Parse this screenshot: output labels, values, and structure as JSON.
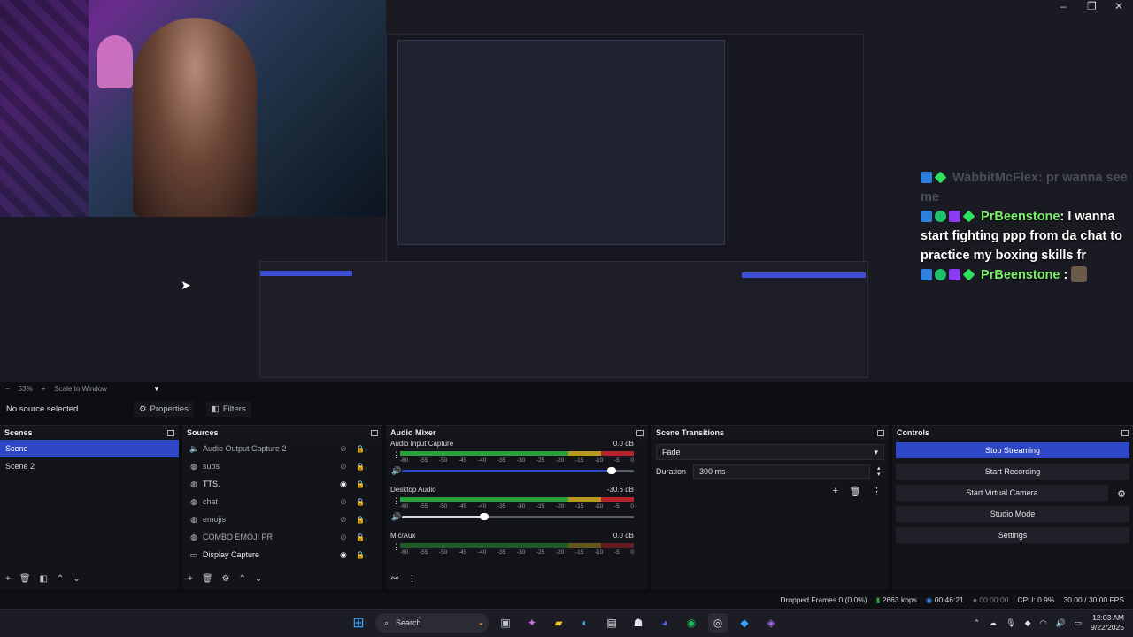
{
  "preview": {
    "chat": [
      {
        "name": "WabbitMcFlex",
        "text": ": pr wanna see me",
        "faded": true
      },
      {
        "name": "PrBeenstone",
        "text": ": I wanna start fighting ppp from da chat to practice my boxing skills fr",
        "faded": false
      },
      {
        "name": "PrBeenstone",
        "text": " :",
        "faded": false
      }
    ]
  },
  "zoombar": {
    "minus": "−",
    "zoom": "53%",
    "plus": "+",
    "scale_mode": "Scale to Window"
  },
  "context": {
    "no_source": "No source selected",
    "properties": "Properties",
    "filters": "Filters"
  },
  "scenes": {
    "title": "Scenes",
    "items": [
      {
        "label": "Scene",
        "selected": true
      },
      {
        "label": "Scene 2",
        "selected": false
      }
    ]
  },
  "sources": {
    "title": "Sources",
    "items": [
      {
        "label": "Audio Output Capture 2",
        "icon": "speaker-icon",
        "visible": false
      },
      {
        "label": "subs",
        "icon": "browser-icon",
        "visible": false
      },
      {
        "label": "TTS.",
        "icon": "browser-icon",
        "visible": true
      },
      {
        "label": "chat",
        "icon": "browser-icon",
        "visible": false
      },
      {
        "label": "emojis",
        "icon": "browser-icon",
        "visible": false
      },
      {
        "label": "COMBO EMOJI PR",
        "icon": "browser-icon",
        "visible": false
      },
      {
        "label": "Display Capture",
        "icon": "monitor-icon",
        "visible": true
      }
    ]
  },
  "mixer": {
    "title": "Audio Mixer",
    "scale": [
      "-60",
      "-55",
      "-50",
      "-45",
      "-40",
      "-35",
      "-30",
      "-25",
      "-20",
      "-15",
      "-10",
      "-5",
      "0"
    ],
    "channels": [
      {
        "name": "Audio Input Capture",
        "db": "0.0 dB",
        "level": 0.92
      },
      {
        "name": "Desktop Audio",
        "db": "-30.6 dB",
        "level": 0.35
      },
      {
        "name": "Mic/Aux",
        "db": "0.0 dB",
        "level": 1.0
      }
    ]
  },
  "transitions": {
    "title": "Scene Transitions",
    "selected": "Fade",
    "duration_label": "Duration",
    "duration_value": "300 ms"
  },
  "controls": {
    "title": "Controls",
    "buttons": [
      "Stop Streaming",
      "Start Recording",
      "Start Virtual Camera",
      "Studio Mode",
      "Settings"
    ]
  },
  "status": {
    "dropped": "Dropped Frames 0 (0.0%)",
    "bitrate": "2663 kbps",
    "stream_time": "00:46:21",
    "rec_time": "00:00:00",
    "cpu": "CPU: 0.9%",
    "fps": "30.00 / 30.00 FPS"
  },
  "taskbar": {
    "search": "Search",
    "time": "12:03 AM",
    "date": "9/22/2025"
  },
  "colors": {
    "accent": "#2f47c7",
    "meter_green": "#2aa13a",
    "chat_name": "#7cf06a"
  }
}
